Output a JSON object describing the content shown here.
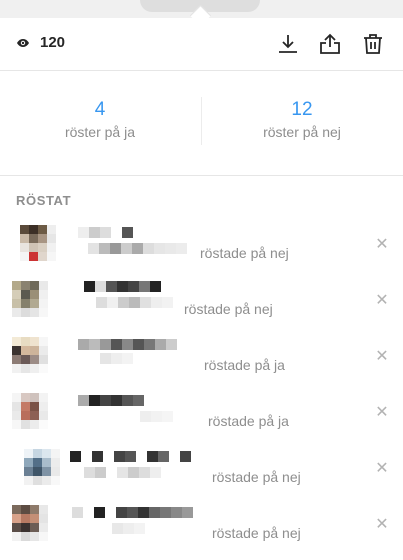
{
  "header": {
    "view_count": "120"
  },
  "stats": {
    "yes_count": "4",
    "yes_label": "röster på ja",
    "no_count": "12",
    "no_label": "röster på nej"
  },
  "section_title": "RÖSTAT",
  "voters": [
    {
      "vote_text": "röstade på nej"
    },
    {
      "vote_text": "röstade på nej"
    },
    {
      "vote_text": "röstade på ja"
    },
    {
      "vote_text": "röstade på ja"
    },
    {
      "vote_text": "röstade på nej"
    },
    {
      "vote_text": "röstade på nej"
    }
  ],
  "icons": {
    "views": "eye-icon",
    "download": "download-icon",
    "share": "share-icon",
    "delete": "trash-icon",
    "remove": "close-icon"
  },
  "colors": {
    "accent": "#3897f0",
    "muted": "#8e8e8e",
    "text": "#262626"
  }
}
